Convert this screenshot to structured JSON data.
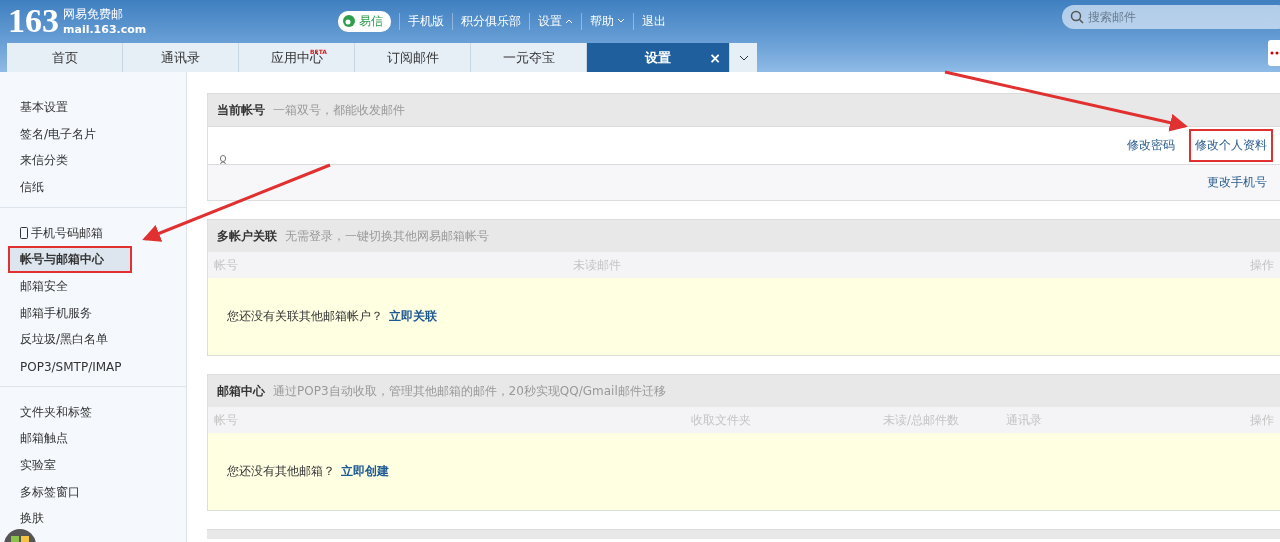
{
  "header": {
    "logo_number": "163",
    "logo_title": "网易免费邮",
    "logo_domain": "mail.163.com",
    "yixin": "易信",
    "links": [
      {
        "label": "手机版",
        "kind": "plain"
      },
      {
        "label": "积分俱乐部",
        "kind": "plain"
      },
      {
        "label": "设置",
        "kind": "dropup"
      },
      {
        "label": "帮助",
        "kind": "dropdown"
      },
      {
        "label": "退出",
        "kind": "plain"
      }
    ],
    "search": {
      "placeholder": "搜索邮件"
    }
  },
  "tabs": [
    {
      "label": "首页",
      "selected": false
    },
    {
      "label": "通讯录",
      "selected": false
    },
    {
      "label": "应用中心",
      "badge": "BETA",
      "selected": false
    },
    {
      "label": "订阅邮件",
      "selected": false
    },
    {
      "label": "一元夺宝",
      "selected": false
    },
    {
      "label": "设置",
      "selected": true,
      "close": "×"
    }
  ],
  "sidebar": {
    "groups": [
      [
        {
          "label": "基本设置",
          "selected": false,
          "highlighted": false
        },
        {
          "label": "签名/电子名片",
          "selected": false,
          "highlighted": false
        },
        {
          "label": "来信分类",
          "selected": false,
          "highlighted": false
        },
        {
          "label": "信纸",
          "selected": false,
          "highlighted": false
        }
      ],
      [
        {
          "label": "手机号码邮箱",
          "kind": "phone",
          "selected": false,
          "highlighted": false
        },
        {
          "label": "帐号与邮箱中心",
          "selected": true,
          "highlighted": true
        },
        {
          "label": "邮箱安全",
          "selected": false,
          "highlighted": false
        },
        {
          "label": "邮箱手机服务",
          "selected": false,
          "highlighted": false
        },
        {
          "label": "反垃圾/黑白名单",
          "selected": false,
          "highlighted": false
        },
        {
          "label": "POP3/SMTP/IMAP",
          "selected": false,
          "highlighted": false
        }
      ],
      [
        {
          "label": "文件夹和标签",
          "selected": false,
          "highlighted": false
        },
        {
          "label": "邮箱触点",
          "selected": false,
          "highlighted": false
        },
        {
          "label": "实验室",
          "selected": false,
          "highlighted": false
        },
        {
          "label": "多标签窗口",
          "selected": false,
          "highlighted": false
        },
        {
          "label": "换肤",
          "selected": false,
          "highlighted": false
        }
      ]
    ]
  },
  "sections": [
    {
      "kind": "accounts",
      "title": "当前帐号",
      "subtitle": "一箱双号，都能收发邮件",
      "rows": [
        {
          "links": [
            {
              "label": "修改密码",
              "highlighted": false
            },
            {
              "label": "修改个人资料",
              "highlighted": true
            }
          ]
        },
        {
          "links": [
            {
              "label": "更改手机号",
              "highlighted": false
            }
          ]
        }
      ]
    },
    {
      "kind": "table",
      "title": "多帐户关联",
      "subtitle": "无需登录，一键切换其他网易邮箱帐号",
      "columns": [
        "帐号",
        "未读邮件",
        "操作"
      ],
      "empty_text": "您还没有关联其他邮箱帐户？",
      "empty_link": "立即关联"
    },
    {
      "kind": "table",
      "title": "邮箱中心",
      "subtitle": "通过POP3自动收取，管理其他邮箱的邮件，20秒实现QQ/Gmail邮件迁移",
      "columns": [
        "帐号",
        "收取文件夹",
        "未读/总邮件数",
        "通讯录",
        "操作"
      ],
      "empty_text": "您还没有其他邮箱？",
      "empty_link": "立即创建"
    }
  ]
}
